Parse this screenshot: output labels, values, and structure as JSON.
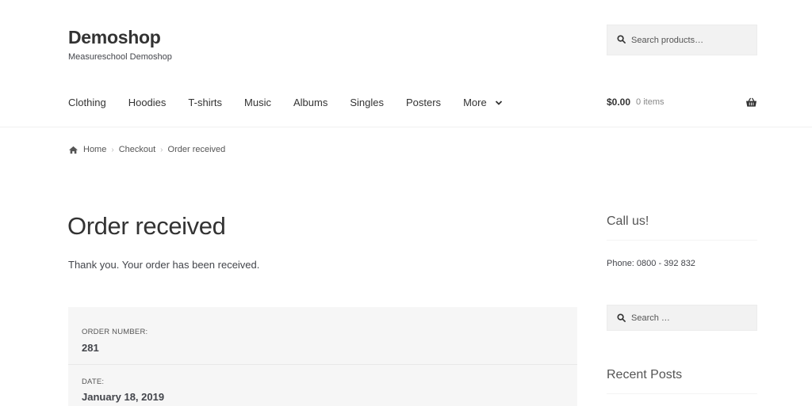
{
  "header": {
    "site_title": "Demoshop",
    "site_description": "Measureschool Demoshop",
    "search_placeholder": "Search products…"
  },
  "nav": {
    "items": [
      "Clothing",
      "Hoodies",
      "T-shirts",
      "Music",
      "Albums",
      "Singles",
      "Posters",
      "More"
    ]
  },
  "cart": {
    "amount": "$0.00",
    "items_label": "0 items"
  },
  "breadcrumb": {
    "home": "Home",
    "checkout": "Checkout",
    "current": "Order received"
  },
  "main": {
    "title": "Order received",
    "thanks": "Thank you. Your order has been received.",
    "order_number_label": "ORDER NUMBER:",
    "order_number": "281",
    "date_label": "DATE:",
    "date": "January 18, 2019"
  },
  "sidebar": {
    "call_heading": "Call us!",
    "phone": "Phone: 0800 - 392 832",
    "search_placeholder": "Search …",
    "recent_heading": "Recent Posts"
  },
  "icons": {
    "search": "search-icon",
    "chevron": "chevron-down-icon",
    "basket": "basket-icon",
    "home": "home-icon"
  }
}
